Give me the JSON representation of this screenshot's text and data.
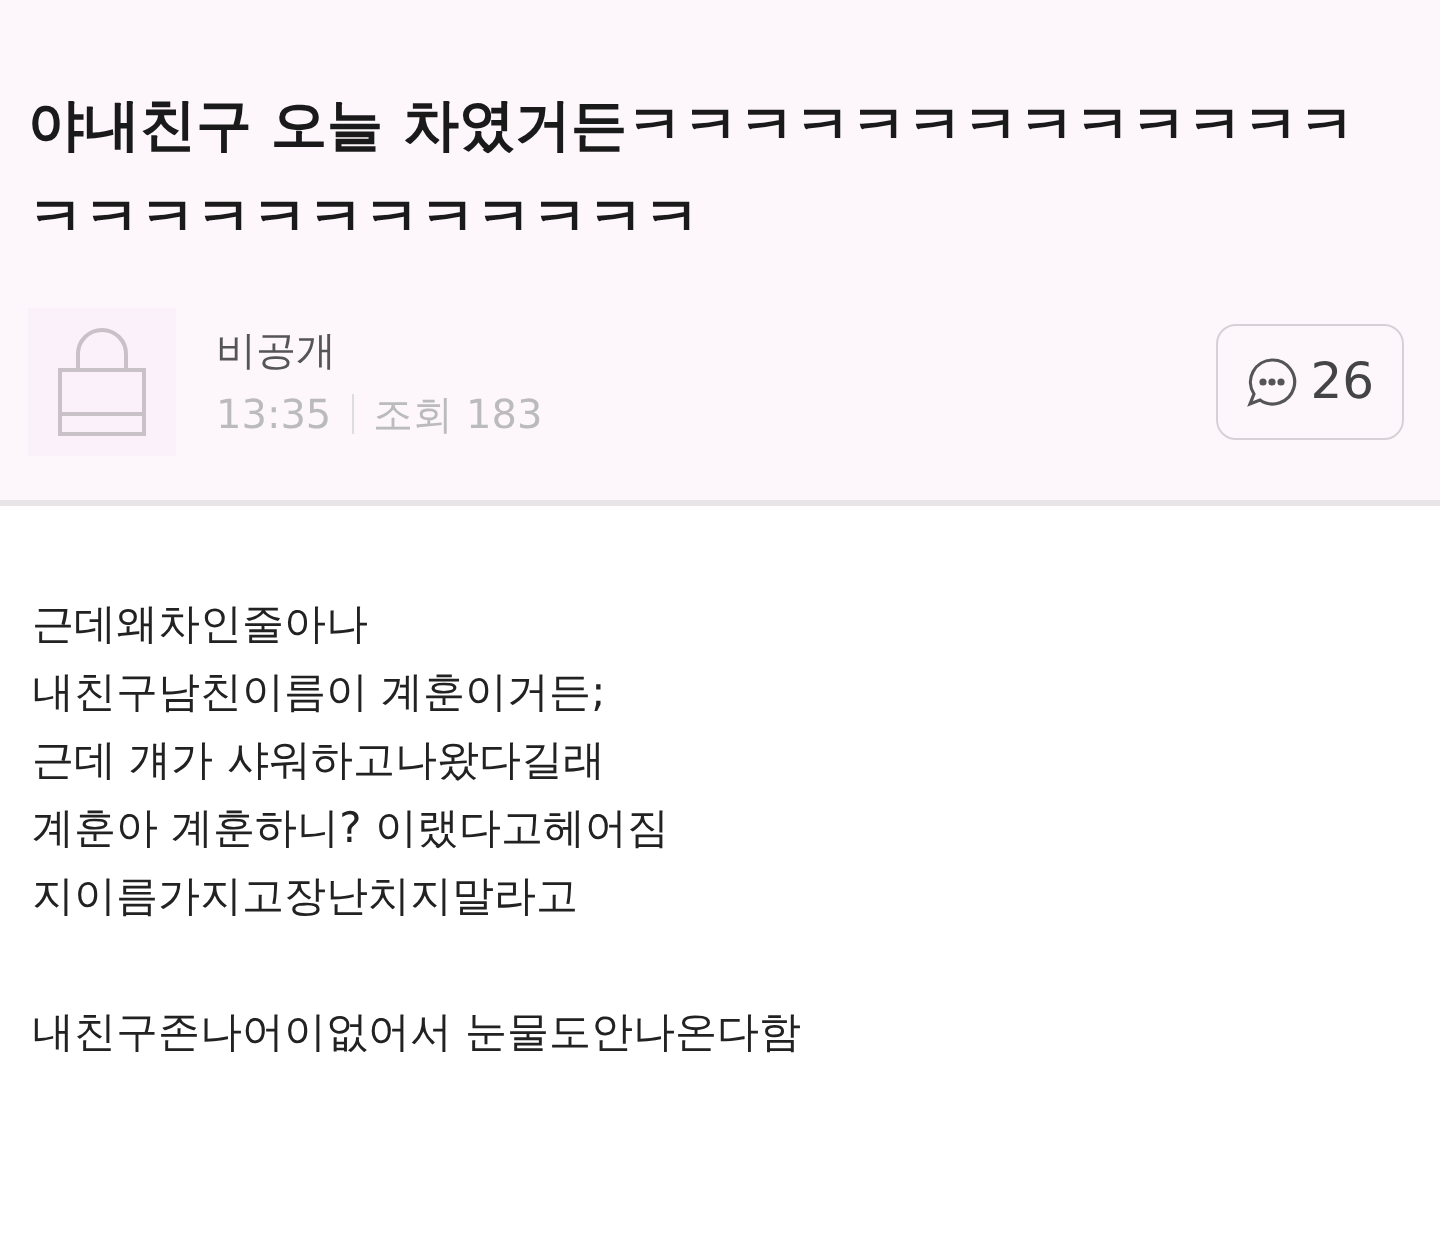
{
  "post": {
    "title": "야내친구 오늘 차였거든ㅋㅋㅋㅋㅋㅋㅋㅋㅋㅋㅋㅋㅋㅋㅋㅋㅋㅋㅋㅋㅋㅋㅋㅋㅋ",
    "author": "비공개",
    "time": "13:35",
    "views": "조회 183",
    "comment_count": "26",
    "body": [
      [
        "근데왜차인줄아나",
        "내친구남친이름이 계훈이거든;",
        "근데 걔가 샤워하고나왔다길래",
        "계훈아 계훈하니? 이랬다고헤어짐",
        "지이름가지고장난치지말라고"
      ],
      [
        "내친구존나어이없어서 눈물도안나온다함"
      ]
    ]
  }
}
